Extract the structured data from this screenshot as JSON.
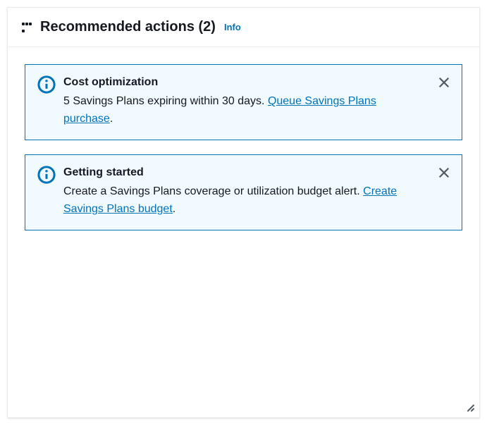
{
  "header": {
    "title": "Recommended actions (2)",
    "info_label": "Info"
  },
  "alerts": [
    {
      "title": "Cost optimization",
      "message_prefix": "5 Savings Plans expiring within 30 days. ",
      "link_text": "Queue Savings Plans purchase",
      "message_suffix": "."
    },
    {
      "title": "Getting started",
      "message_prefix": "Create a Savings Plans coverage or utilization budget alert. ",
      "link_text": "Create Savings Plans budget",
      "message_suffix": "."
    }
  ]
}
